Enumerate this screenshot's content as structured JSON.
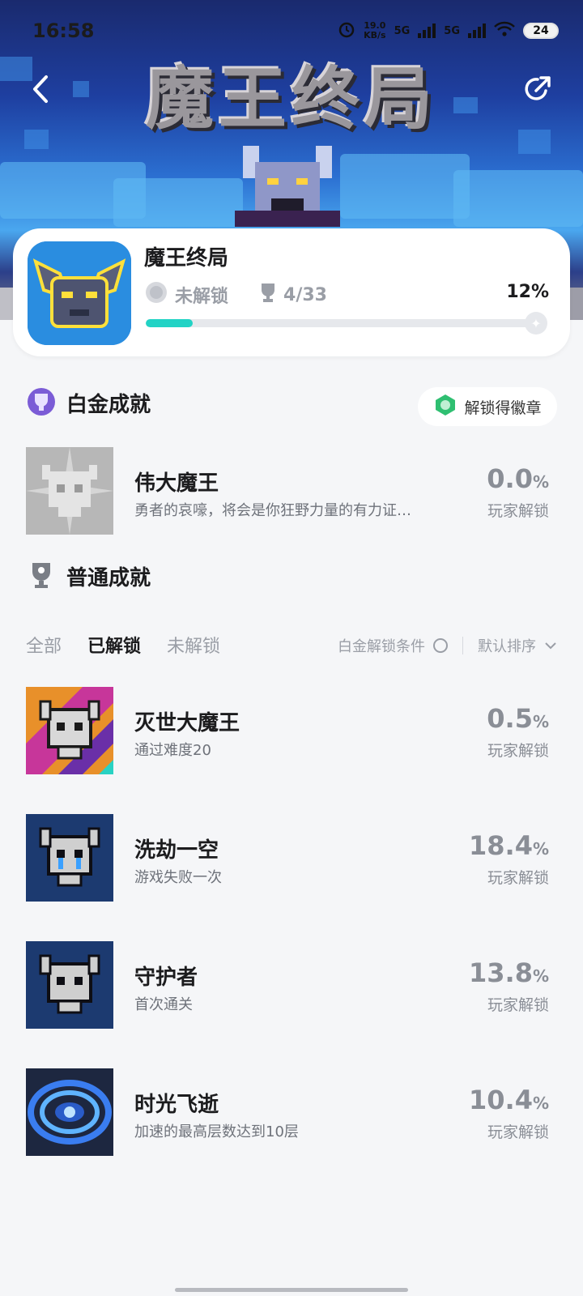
{
  "status_bar": {
    "time": "16:58",
    "net_speed_value": "19.0",
    "net_speed_unit": "KB/s",
    "signal1": "5G",
    "signal2": "5G",
    "battery": "24"
  },
  "banner": {
    "game_title_art": "魔王终局"
  },
  "header": {
    "game_name": "魔王终局",
    "platinum_status": "未解锁",
    "trophy_count": "4/33",
    "progress_percent": "12%",
    "progress_value": 0.12
  },
  "platinum_section": {
    "title": "白金成就",
    "badge_button": "解锁得徽章",
    "item": {
      "name": "伟大魔王",
      "description": "勇者的哀嚎，将会是你狂野力量的有力证…",
      "rate": "0.0",
      "rate_unit": "%",
      "rate_label": "玩家解锁"
    }
  },
  "normal_section": {
    "title": "普通成就",
    "tabs": [
      "全部",
      "已解锁",
      "未解锁"
    ],
    "active_tab": 1,
    "filter_condition": "白金解锁条件",
    "sort_label": "默认排序",
    "items": [
      {
        "name": "灭世大魔王",
        "description": "通过难度20",
        "rate": "0.5",
        "rate_unit": "%",
        "rate_label": "玩家解锁"
      },
      {
        "name": "洗劫一空",
        "description": "游戏失败一次",
        "rate": "18.4",
        "rate_unit": "%",
        "rate_label": "玩家解锁"
      },
      {
        "name": "守护者",
        "description": "首次通关",
        "rate": "13.8",
        "rate_unit": "%",
        "rate_label": "玩家解锁"
      },
      {
        "name": "时光飞逝",
        "description": "加速的最高层数达到10层",
        "rate": "10.4",
        "rate_unit": "%",
        "rate_label": "玩家解锁"
      }
    ]
  },
  "colors": {
    "accent_progress": "#22d3c5",
    "rate_gray": "#8a8e96"
  }
}
